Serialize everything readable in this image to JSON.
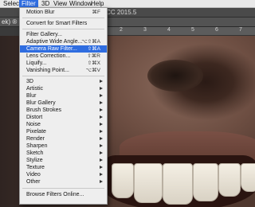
{
  "menubar": {
    "items": [
      {
        "label": "Select"
      },
      {
        "label": "Filter"
      },
      {
        "label": "3D"
      },
      {
        "label": "View"
      },
      {
        "label": "Window"
      },
      {
        "label": "Help"
      }
    ]
  },
  "document": {
    "title_fragment": "op CC 2015.5",
    "tab_label_fragment": "ek) ® ×",
    "ruler_numbers": [
      "1",
      "2",
      "3",
      "4",
      "5",
      "6",
      "7"
    ]
  },
  "filter_menu": {
    "items": [
      {
        "label": "Motion Blur",
        "shortcut": "⌘F"
      },
      {
        "label": "Convert for Smart Filters",
        "shortcut": ""
      },
      {
        "label": "Filter Gallery...",
        "shortcut": ""
      },
      {
        "label": "Adaptive Wide Angle...",
        "shortcut": "⌥⇧⌘A"
      },
      {
        "label": "Camera Raw Filter...",
        "shortcut": "⇧⌘A"
      },
      {
        "label": "Lens Correction...",
        "shortcut": "⇧⌘R"
      },
      {
        "label": "Liquify...",
        "shortcut": "⇧⌘X"
      },
      {
        "label": "Vanishing Point...",
        "shortcut": "⌥⌘V"
      },
      {
        "label": "3D",
        "submenu": true
      },
      {
        "label": "Artistic",
        "submenu": true
      },
      {
        "label": "Blur",
        "submenu": true
      },
      {
        "label": "Blur Gallery",
        "submenu": true
      },
      {
        "label": "Brush Strokes",
        "submenu": true
      },
      {
        "label": "Distort",
        "submenu": true
      },
      {
        "label": "Noise",
        "submenu": true
      },
      {
        "label": "Pixelate",
        "submenu": true
      },
      {
        "label": "Render",
        "submenu": true
      },
      {
        "label": "Sharpen",
        "submenu": true
      },
      {
        "label": "Sketch",
        "submenu": true
      },
      {
        "label": "Stylize",
        "submenu": true
      },
      {
        "label": "Texture",
        "submenu": true
      },
      {
        "label": "Video",
        "submenu": true
      },
      {
        "label": "Other",
        "submenu": true
      },
      {
        "label": "Browse Filters Online...",
        "shortcut": ""
      }
    ],
    "highlighted_label": "Camera Raw Filter..."
  },
  "colors": {
    "highlight": "#2f6de0",
    "menu_bg": "#eeeeee"
  }
}
